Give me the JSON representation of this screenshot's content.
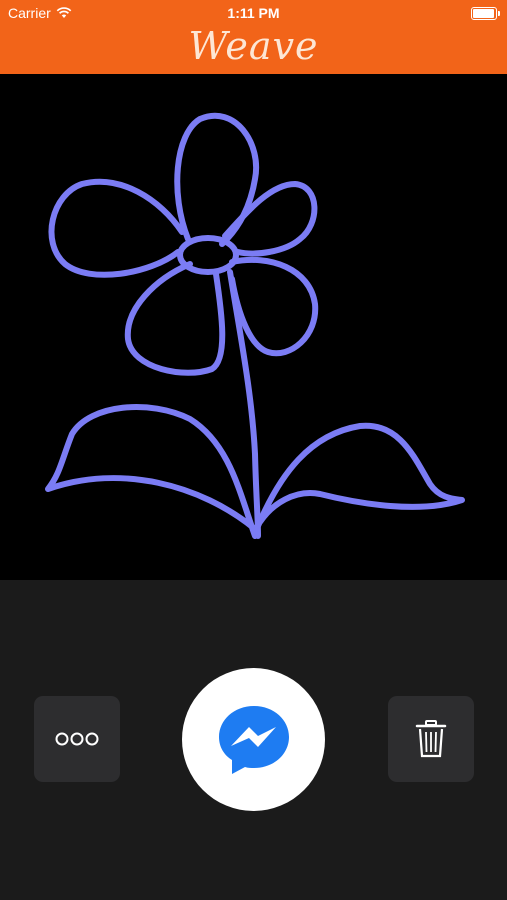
{
  "status_bar": {
    "carrier": "Carrier",
    "time": "1:11 PM",
    "battery_level": 1.0
  },
  "app": {
    "title": "Weave",
    "header_color": "#f26419"
  },
  "canvas": {
    "background": "#000000",
    "stroke_color": "#7b7cf4"
  },
  "toolbar": {
    "more_icon": "more-dots-icon",
    "send_icon": "messenger-icon",
    "trash_icon": "trash-icon",
    "messenger_color": "#1e7cf2"
  }
}
